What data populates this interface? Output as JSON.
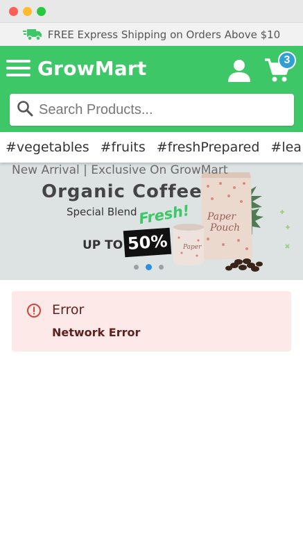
{
  "window": {
    "controls": [
      "close",
      "minimize",
      "maximize"
    ]
  },
  "promo": {
    "icon": "delivery-truck-icon",
    "text": "FREE Express Shipping on Orders Above $10"
  },
  "header": {
    "brand": "GrowMart",
    "menu_icon": "hamburger-menu-icon",
    "account_icon": "user-icon",
    "cart_icon": "cart-icon",
    "cart_count": "3",
    "brand_color": "#3ec766",
    "badge_color": "#2f9fd8"
  },
  "search": {
    "icon": "search-icon",
    "placeholder": "Search Products..."
  },
  "tags": [
    "#vegetables",
    "#fruits",
    "#freshPrepared",
    "#lea"
  ],
  "banner": {
    "top_line": "New Arrival | Exclusive On GrowMart",
    "title": "Organic Coffee",
    "subtitle": "Special Blend",
    "accent": "Fresh!",
    "offer_prefix": "UP TO",
    "offer_value": "50%",
    "slides": 3,
    "active_slide": 2
  },
  "alert": {
    "icon": "error-icon",
    "title": "Error",
    "message": "Network Error",
    "background": "#fde9e7",
    "icon_color": "#d9423a"
  }
}
